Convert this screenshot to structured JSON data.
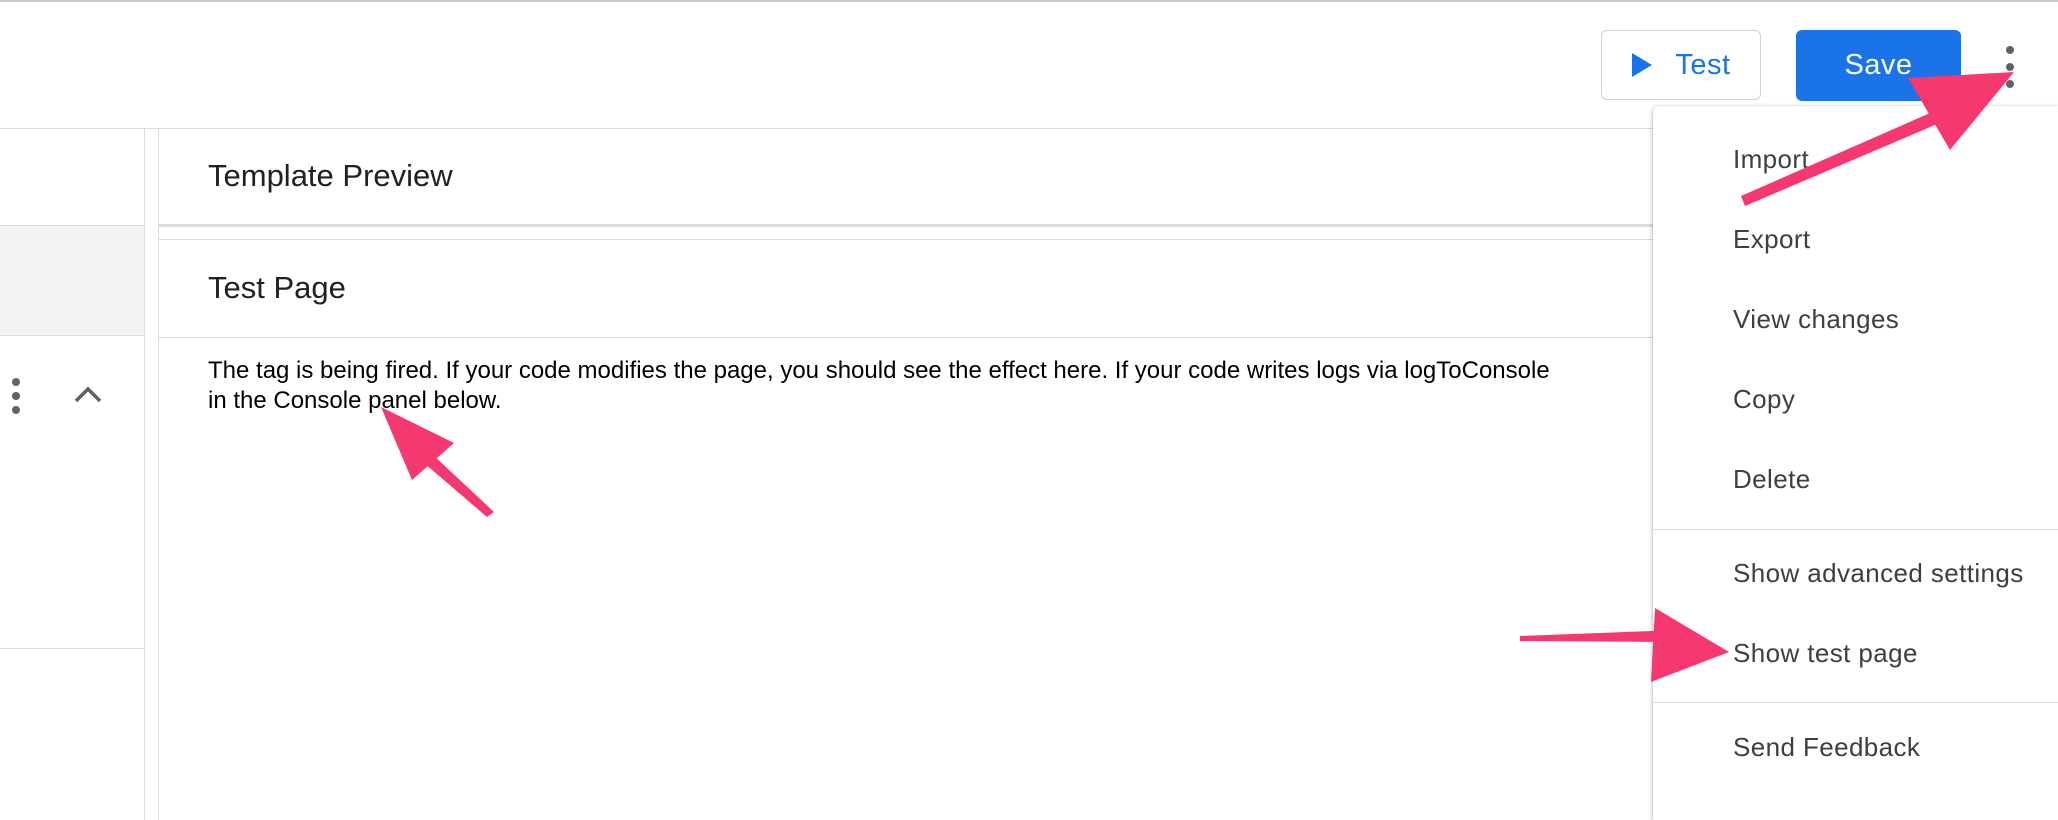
{
  "toolbar": {
    "test_label": "Test",
    "save_label": "Save"
  },
  "sections": {
    "template_preview_title": "Template Preview",
    "test_page_title": "Test Page",
    "test_page_message_line1": "The tag is being fired. If your code modifies the page, you should see the effect here. If your code writes logs via logToConsole",
    "test_page_message_line2": "in the Console panel below."
  },
  "menu": {
    "items": [
      {
        "label": "Import"
      },
      {
        "label": "Export"
      },
      {
        "label": "View changes"
      },
      {
        "label": "Copy"
      },
      {
        "label": "Delete"
      },
      {
        "label": "Show advanced settings"
      },
      {
        "label": "Show test page"
      },
      {
        "label": "Send Feedback"
      }
    ]
  },
  "colors": {
    "accent": "#1a73e8",
    "annotation_arrow": "#f5386f"
  },
  "icons": {
    "test": "play-icon",
    "overflow": "more-vert-icon",
    "row_overflow": "more-vert-icon",
    "collapse": "chevron-up-icon"
  }
}
